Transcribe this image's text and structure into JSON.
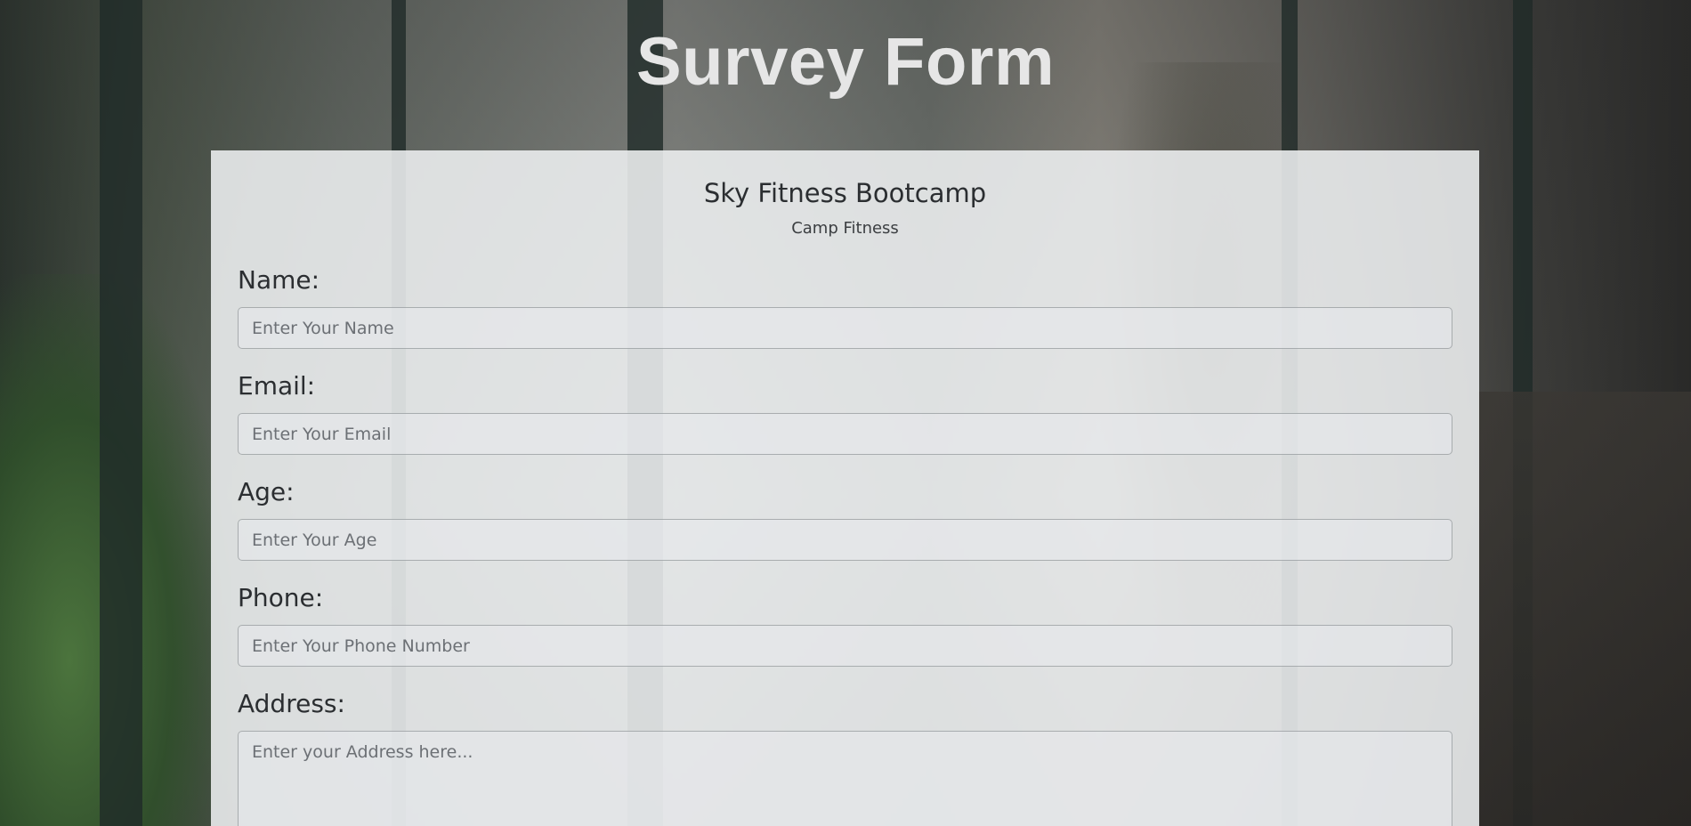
{
  "page": {
    "title": "Survey Form"
  },
  "form": {
    "heading": "Sky Fitness Bootcamp",
    "subheading": "Camp Fitness",
    "fields": [
      {
        "label": "Name:",
        "placeholder": "Enter Your Name"
      },
      {
        "label": "Email:",
        "placeholder": "Enter Your Email"
      },
      {
        "label": "Age:",
        "placeholder": "Enter Your Age"
      },
      {
        "label": "Phone:",
        "placeholder": "Enter Your Phone Number"
      },
      {
        "label": "Address:",
        "placeholder": "Enter your Address here..."
      }
    ]
  },
  "colors": {
    "title_text": "#e6e6e6",
    "card_background": "#eef0f1",
    "body_text": "#2b2e31"
  }
}
